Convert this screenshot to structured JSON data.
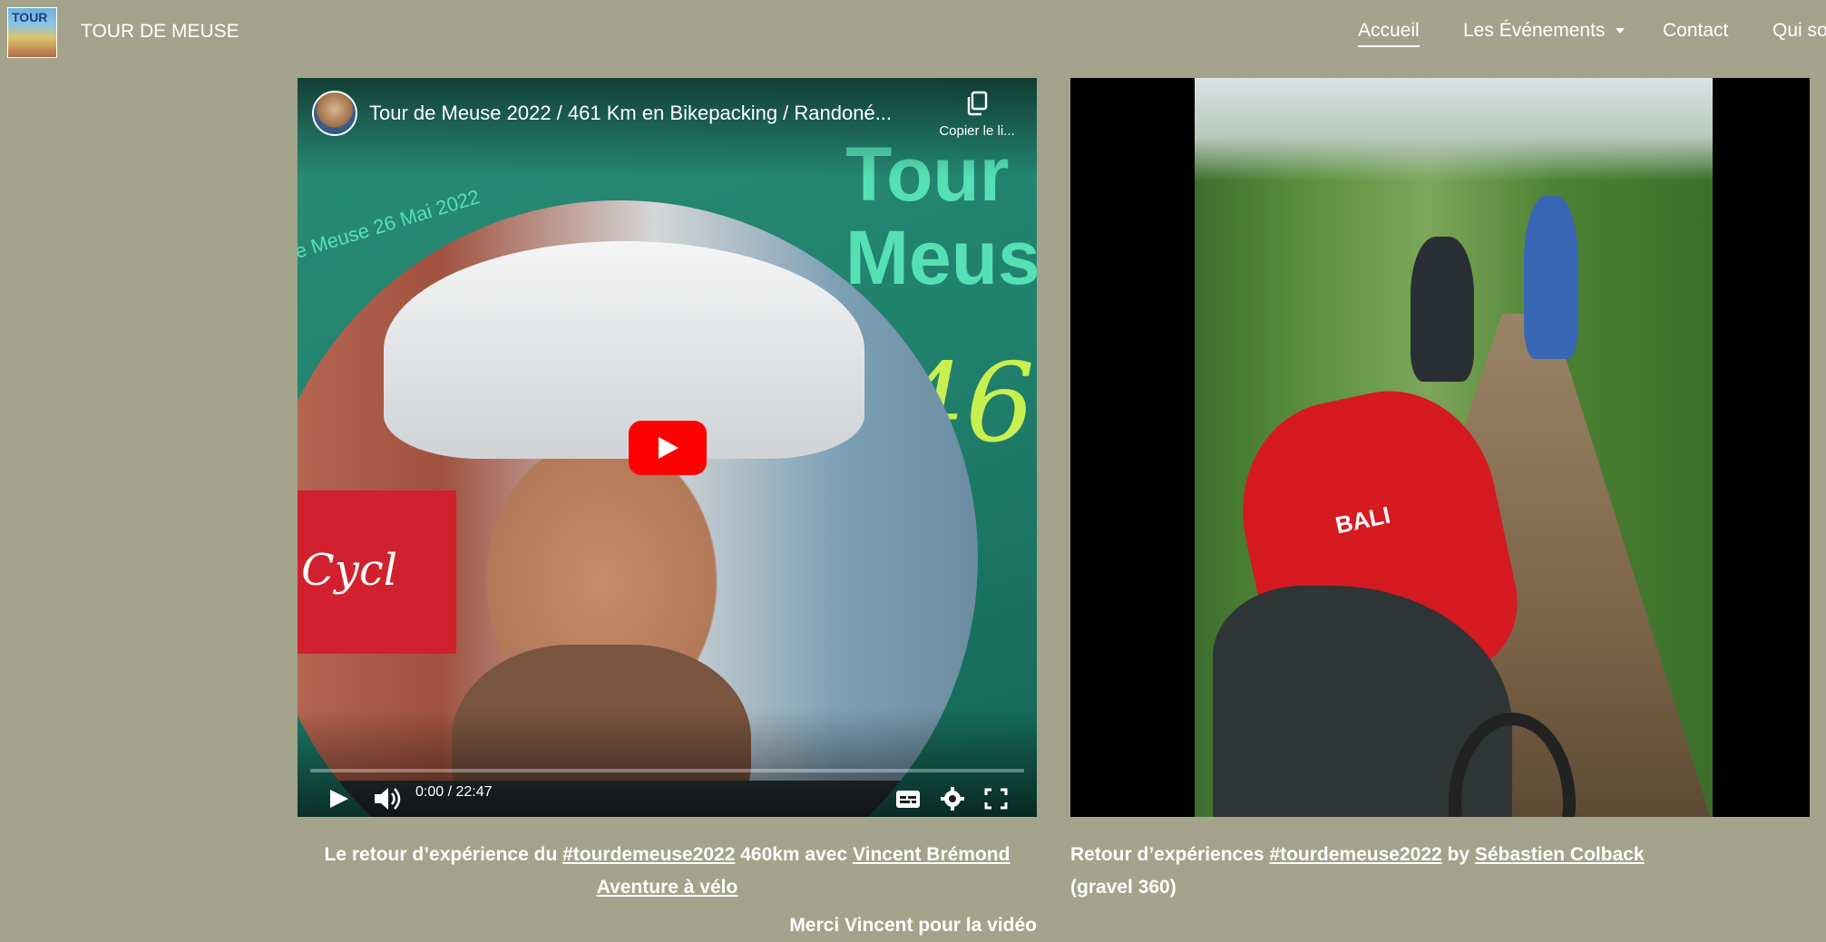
{
  "header": {
    "logo_text": "TOUR",
    "brand": "TOUR DE MEUSE",
    "nav": [
      {
        "label": "Accueil",
        "active": true
      },
      {
        "label": "Les Événements",
        "dropdown": true
      },
      {
        "label": "Contact"
      },
      {
        "label": "Qui so"
      }
    ]
  },
  "video1": {
    "title": "Tour de Meuse 2022 / 461 Km en Bikepacking / Randoné...",
    "copy_link_label": "Copier le li...",
    "thumbnail": {
      "big_title": "Tour\nMeus",
      "arc_text": "e Meuse 26 Mai 2022",
      "number": "46",
      "sign_text": "Cycl"
    },
    "time": "0:00 / 22:47",
    "progress": 0,
    "icons": [
      "play-icon",
      "volume-icon",
      "subtitles-icon",
      "settings-icon",
      "fullscreen-icon",
      "copy-icon"
    ]
  },
  "video2": {
    "bag_label": "BALI"
  },
  "captions": {
    "left": {
      "prefix": "Le retour d’expérience du ",
      "hashtag": "#tourdemeuse2022",
      "middle": " 460km  avec ",
      "link1": "Vincent Brémond ",
      "link2": "Aventure à vélo",
      "thanks": "Merci Vincent pour la vidéo"
    },
    "right": {
      "prefix": "Retour d’expériences ",
      "hashtag": "#tourdemeuse2022",
      "middle": " by ",
      "link": "Sébastien Colback",
      "suffix": "(gravel 360)"
    }
  },
  "colors": {
    "page_bg": "#a2a38a",
    "youtube_red": "#ff0000",
    "thumb_accent": "#55e0b4",
    "thumb_number": "#c8ef50"
  }
}
